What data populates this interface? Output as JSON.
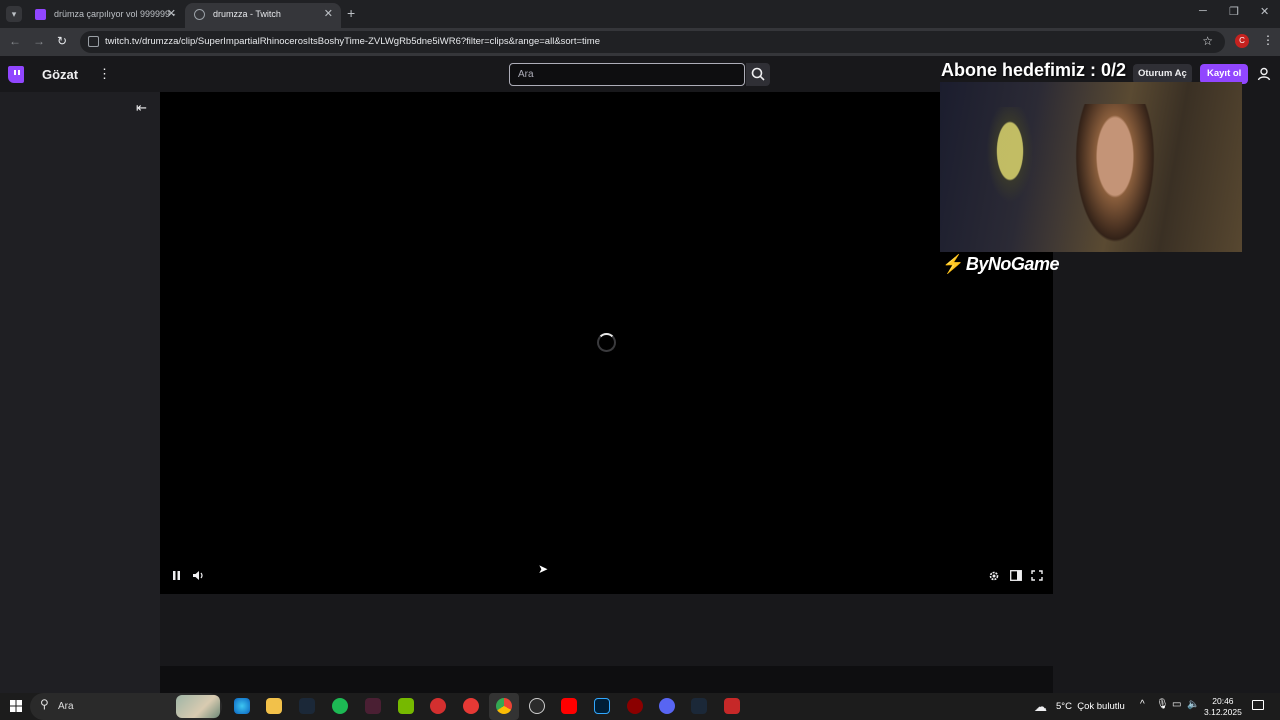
{
  "browser": {
    "tabs": [
      {
        "title": "drümza çarpılıyor vol 999999 -"
      },
      {
        "title": "drumzza - Twitch"
      }
    ],
    "url": "twitch.tv/drumzza/clip/SuperImpartialRhinocerosItsBoshyTime-ZVLWgRb5dne5iWR6?filter=clips&range=all&sort=time",
    "profile_initial": "C"
  },
  "twitch": {
    "browse_label": "Gözat",
    "search_placeholder": "Ara",
    "login_label": "Oturum Aç",
    "signup_label": "Kayıt ol"
  },
  "overlay": {
    "goal_text": "Abone hedefimiz : 0/2",
    "sponsor_text": "ByNoGame"
  },
  "taskbar": {
    "search_placeholder": "Ara",
    "weather_temp": "5°C",
    "weather_desc": "Çok bulutlu",
    "time": "20:46",
    "date": "3.12.2025"
  },
  "colors": {
    "twitch_purple": "#9146ff",
    "player_bg": "#000000",
    "page_bg": "#0e0e10"
  }
}
